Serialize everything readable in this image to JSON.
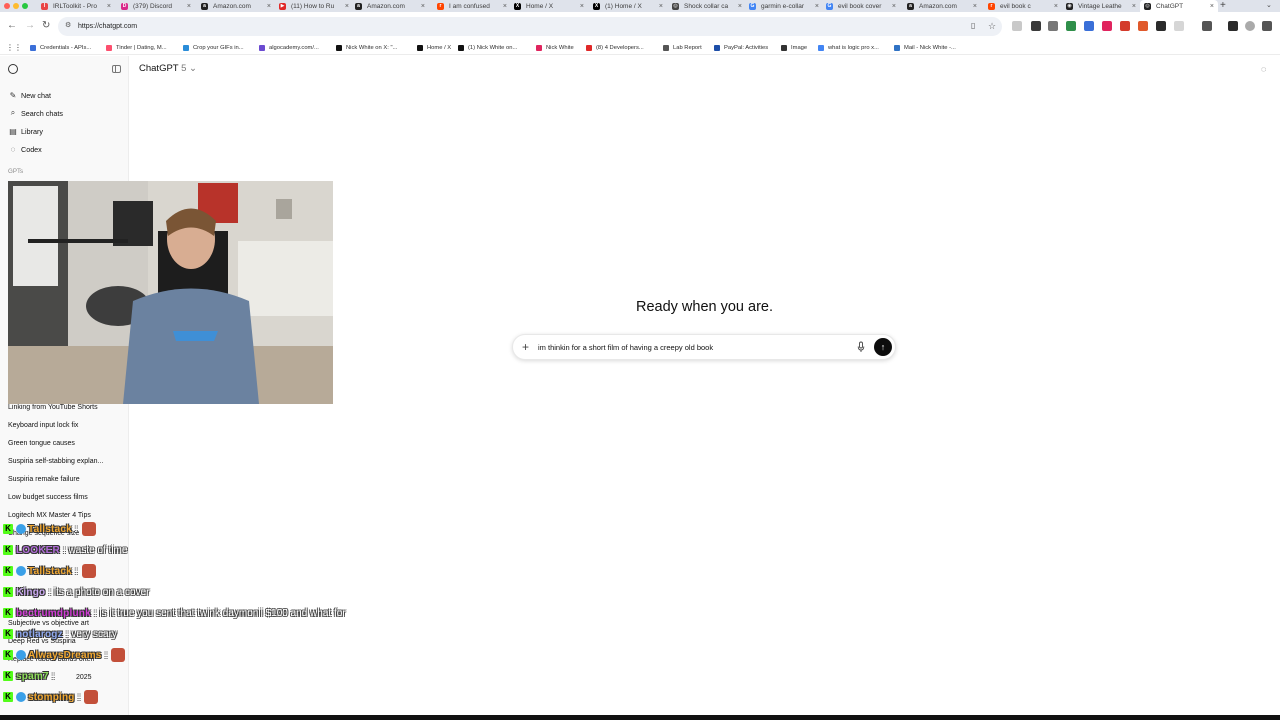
{
  "browser": {
    "tabs": [
      {
        "title": "IRLToolkit - Pro",
        "color": "#e94545",
        "glyph": "I"
      },
      {
        "title": "(379) Discord",
        "color": "#d9288a",
        "glyph": "D"
      },
      {
        "title": "Amazon.com",
        "color": "#222222",
        "glyph": "a"
      },
      {
        "title": "(11) How to Ru",
        "color": "#e02828",
        "glyph": "▶"
      },
      {
        "title": "Amazon.com",
        "color": "#222222",
        "glyph": "a"
      },
      {
        "title": "I am confused",
        "color": "#ff4500",
        "glyph": "r"
      },
      {
        "title": "Home / X",
        "color": "#000000",
        "glyph": "X"
      },
      {
        "title": "(1) Home / X",
        "color": "#000000",
        "glyph": "X"
      },
      {
        "title": "Shock collar ca",
        "color": "#444444",
        "glyph": "◎"
      },
      {
        "title": "garmin e-collar",
        "color": "#4285f4",
        "glyph": "G"
      },
      {
        "title": "evil book cover",
        "color": "#4285f4",
        "glyph": "G"
      },
      {
        "title": "Amazon.com",
        "color": "#222222",
        "glyph": "a"
      },
      {
        "title": "evil book c",
        "color": "#ff4500",
        "glyph": "r"
      },
      {
        "title": "Vintage Leathe",
        "color": "#222222",
        "glyph": "◉"
      },
      {
        "title": "ChatGPT",
        "color": "#222222",
        "glyph": "◎"
      }
    ],
    "active_tab_index": 14,
    "new_tab": "+",
    "url": "https://chatgpt.com",
    "bookmarks": [
      {
        "label": "Credentials - APIs...",
        "color": "#3b6fd8"
      },
      {
        "label": "Tinder | Dating, M...",
        "color": "#fd4f6e"
      },
      {
        "label": "Crop your GIFs in...",
        "color": "#2a8cd8"
      },
      {
        "label": "algocademy.com/...",
        "color": "#6b4bd1"
      },
      {
        "label": "Nick White on X: \"...",
        "color": "#111111"
      },
      {
        "label": "Home / X",
        "color": "#111111"
      },
      {
        "label": "(1) Nick White on...",
        "color": "#111111"
      },
      {
        "label": "Nick White",
        "color": "#e0245e"
      },
      {
        "label": "(8) 4 Developers...",
        "color": "#e02828"
      },
      {
        "label": "Lab Report",
        "color": "#555555"
      },
      {
        "label": "PayPal: Activities",
        "color": "#1d4ea8"
      },
      {
        "label": "Image",
        "color": "#333333"
      },
      {
        "label": "what is logic pro x...",
        "color": "#4285f4"
      },
      {
        "label": "Mail - Nick White -...",
        "color": "#2f72c4"
      }
    ]
  },
  "sidebar": {
    "menu": [
      {
        "label": "New chat",
        "icon": "edit-icon"
      },
      {
        "label": "Search chats",
        "icon": "search-icon"
      },
      {
        "label": "Library",
        "icon": "library-icon"
      },
      {
        "label": "Codex",
        "icon": "codex-icon"
      }
    ],
    "section_label": "GPTs",
    "chats": [
      "Linking from YouTube Shorts",
      "Keyboard input lock fix",
      "Green tongue causes",
      "Suspiria self-stabbing explan...",
      "Suspiria remake failure",
      "Low budget success films",
      "Logitech MX Master 4 Tips",
      "Change sequence size",
      "Subjective vs objective art",
      "Deep Red vs Suspiria",
      "Replace rubber bands often",
      "2025"
    ]
  },
  "main": {
    "model_name": "ChatGPT",
    "model_version": "5",
    "hero_text": "Ready when you are.",
    "composer_value": "im thinkin for a short film of having a creepy old book"
  },
  "stream_chat": [
    {
      "user": "Tallstack",
      "color": "#f2a830",
      "message": ":",
      "emote": true
    },
    {
      "user": "LOOKER",
      "color": "#b06bd8",
      "message": ": waste of time",
      "emote": false
    },
    {
      "user": "Tallstack",
      "color": "#f2a830",
      "message": ":",
      "emote": true
    },
    {
      "user": "Kingo",
      "color": "#c9a7f0",
      "message": ": its a photo on a cover",
      "emote": false
    },
    {
      "user": "bectrumdplunk",
      "color": "#d23bd6",
      "message": ": is it true you sent that twink daymonii $100 and what for",
      "emote": false
    },
    {
      "user": "notlarogz",
      "color": "#8fa8f0",
      "message": ": very scary",
      "emote": false
    },
    {
      "user": "AlwaysDreams",
      "color": "#f2a830",
      "message": ":",
      "emote": true
    },
    {
      "user": "spam7",
      "color": "#8fe05a",
      "message": ":",
      "emote": false
    },
    {
      "user": "stomping",
      "color": "#f2a830",
      "message": ":",
      "emote": true
    }
  ]
}
